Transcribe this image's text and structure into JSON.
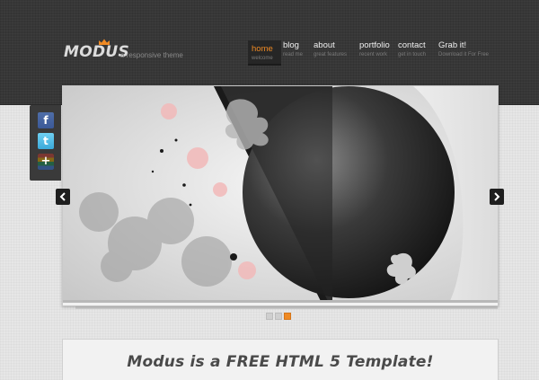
{
  "brand": {
    "logo_text": "MODUS",
    "tagline": "a responsive theme"
  },
  "nav": {
    "items": [
      {
        "label": "home",
        "sub": "welcome"
      },
      {
        "label": "blog",
        "sub": "read me"
      },
      {
        "label": "about",
        "sub": "great features"
      },
      {
        "label": "portfolio",
        "sub": "recent work"
      },
      {
        "label": "contact",
        "sub": "get in touch"
      },
      {
        "label": "Grab it!",
        "sub": "Download it For Free"
      }
    ],
    "active_index": 0
  },
  "social": {
    "icons": [
      "facebook-icon",
      "twitter-icon",
      "google-plus-icon"
    ]
  },
  "slider": {
    "slides": 3,
    "active_slide": 3
  },
  "content": {
    "headline": "Modus is a FREE HTML 5 Template!"
  },
  "colors": {
    "accent": "#ef8a24",
    "header_bg": "#373737",
    "page_bg": "#e6e6e6"
  }
}
